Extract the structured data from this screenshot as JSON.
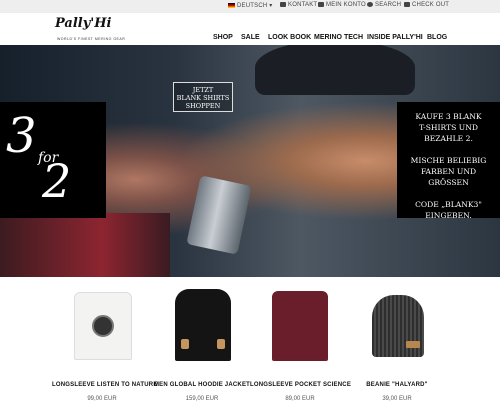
{
  "topbar": {
    "language": "DEUTSCH",
    "contact": "KONTAKT",
    "account": "MEIN KONTO",
    "search": "SEARCH",
    "checkout": "CHECK OUT"
  },
  "brand": {
    "logo": "Pally'Hi",
    "tagline": "WORLD'S FINEST MERINO GEAR"
  },
  "nav": [
    "SHOP",
    "SALE",
    "LOOK BOOK",
    "MERINO TECH",
    "INSIDE PALLY'HI",
    "BLOG"
  ],
  "hero": {
    "cta": "JETZT\nBLANK SHIRTS\nSHOPPEN",
    "promo_left": {
      "three": "3",
      "for": "for",
      "two": "2"
    },
    "promo_right": "KAUFE 3 BLANK\nT-SHIRTS UND\nBEZAHLE 2.\n\nMISCHE BELIEBIG\nFARBEN UND GRÖSSEN\n\nCODE „BLANK3\"\nEINGEBEN."
  },
  "products": [
    {
      "name": "LONGSLEEVE LISTEN TO NATURE",
      "price": "99,00 EUR"
    },
    {
      "name": "MEN GLOBAL HOODIE JACKET",
      "price": "159,00 EUR"
    },
    {
      "name": "LONGSLEEVE POCKET SCIENCE",
      "price": "89,00 EUR"
    },
    {
      "name": "BEANIE \"HALYARD\"",
      "price": "39,00 EUR"
    }
  ],
  "colors": {
    "topbar": "#eeeeee",
    "promo": "#000000",
    "text": "#111111"
  }
}
